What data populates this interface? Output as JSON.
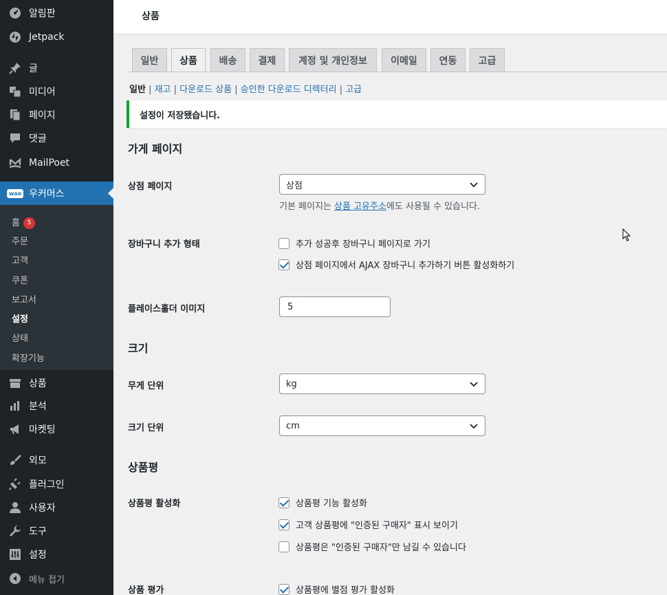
{
  "sidebar": {
    "items": [
      {
        "label": "알림판",
        "icon": "dashboard-icon"
      },
      {
        "label": "Jetpack",
        "icon": "jetpack-icon"
      },
      {
        "label": "글",
        "icon": "pin-icon"
      },
      {
        "label": "미디어",
        "icon": "media-icon"
      },
      {
        "label": "페이지",
        "icon": "pages-icon"
      },
      {
        "label": "댓글",
        "icon": "comments-icon"
      },
      {
        "label": "MailPoet",
        "icon": "mailpoet-icon"
      },
      {
        "label": "우커머스",
        "icon": "woocommerce-icon",
        "badge": "woo"
      },
      {
        "label": "상품",
        "icon": "products-icon"
      },
      {
        "label": "분석",
        "icon": "analytics-icon"
      },
      {
        "label": "마켓팅",
        "icon": "megaphone-icon"
      },
      {
        "label": "외모",
        "icon": "brush-icon"
      },
      {
        "label": "플러그인",
        "icon": "plugin-icon"
      },
      {
        "label": "사용자",
        "icon": "users-icon"
      },
      {
        "label": "도구",
        "icon": "wrench-icon"
      },
      {
        "label": "설정",
        "icon": "settings-icon"
      },
      {
        "label": "메뉴 접기",
        "icon": "collapse-icon"
      }
    ],
    "submenu": [
      "홈",
      "주문",
      "고객",
      "쿠폰",
      "보고서",
      "설정",
      "상태",
      "확장기능"
    ],
    "home_count": "5"
  },
  "header": {
    "title": "상품"
  },
  "tabs": [
    "일반",
    "상품",
    "배송",
    "결제",
    "계정 및 개인정보",
    "이메일",
    "연동",
    "고급"
  ],
  "subnav": {
    "current": "일반",
    "links": [
      "재고",
      "다운로드 상품",
      "승인한 다운로드 디렉터리",
      "고급"
    ]
  },
  "notice": "설정이 저장됐습니다.",
  "sections": {
    "shop_pages": "가게 페이지",
    "dimensions": "크기",
    "reviews": "상품평"
  },
  "fields": {
    "shop_page": {
      "label": "상점 페이지",
      "value": "상점",
      "desc_pre": "기본 페이지는 ",
      "desc_link": "상품 고유주소",
      "desc_post": "에도 사용될 수 있습니다."
    },
    "add_to_cart": {
      "label": "장바구니 추가 형태",
      "options": [
        {
          "text": "추가 성공후 장바구니 페이지로 가기",
          "checked": false
        },
        {
          "text": "상점 페이지에서 AJAX 장바구니 추가하기 버튼 활성화하기",
          "checked": true
        }
      ]
    },
    "placeholder": {
      "label": "플레이스홀더 이미지",
      "value": "5"
    },
    "weight_unit": {
      "label": "무게 단위",
      "value": "kg"
    },
    "dimension_unit": {
      "label": "크기 단위",
      "value": "cm"
    },
    "enable_reviews": {
      "label": "상품평 활성화",
      "options": [
        {
          "text": "상품평 기능 활성화",
          "checked": true
        },
        {
          "text": "고객 상품평에 \"인증된 구매자\" 표시 보이기",
          "checked": true
        },
        {
          "text": "상품평은 \"인증된 구매자\"만 남길 수 있습니다",
          "checked": false
        }
      ]
    },
    "product_ratings": {
      "label": "상품 평가",
      "options": [
        {
          "text": "상품평에 별점 평가 활성화",
          "checked": true
        }
      ]
    }
  },
  "colors": {
    "accent": "#2271b1",
    "sidebar": "#1d2327",
    "success": "#00a32a",
    "badge": "#d63638"
  }
}
